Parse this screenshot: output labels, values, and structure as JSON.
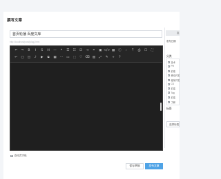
{
  "header": {
    "title": "撰写文章"
  },
  "post": {
    "title": "首页轮播 百度文库",
    "url_hint": "http://localhost/post/{slug}.html"
  },
  "editor": {
    "toolbar_row1": [
      {
        "icon": "undo-icon",
        "glyph": "↶"
      },
      {
        "icon": "redo-icon",
        "glyph": "↷"
      },
      {
        "icon": "bold-icon",
        "glyph": "B"
      },
      {
        "icon": "italic-icon",
        "glyph": "I"
      },
      {
        "icon": "strikethrough-icon",
        "glyph": "S"
      },
      {
        "icon": "heading-icon",
        "glyph": "H"
      },
      {
        "icon": "horizontal-rule-icon",
        "glyph": "—"
      },
      {
        "icon": "blockquote-icon",
        "glyph": "❝"
      },
      {
        "icon": "unordered-list-icon",
        "glyph": "☰"
      },
      {
        "icon": "ordered-list-icon",
        "glyph": "☷"
      },
      {
        "icon": "checklist-icon",
        "glyph": "☑"
      },
      {
        "icon": "indent-icon",
        "glyph": "⇥"
      },
      {
        "icon": "link-icon",
        "glyph": "⚭"
      },
      {
        "icon": "image-icon",
        "glyph": "▣"
      },
      {
        "icon": "code-icon",
        "glyph": "</>"
      },
      {
        "icon": "table-icon",
        "glyph": "▦"
      },
      {
        "icon": "info-icon",
        "glyph": "ⓘ"
      },
      {
        "icon": "chevron-right-icon",
        "glyph": "›"
      },
      {
        "icon": "upload-icon",
        "glyph": "⤒"
      },
      {
        "icon": "printer-icon",
        "glyph": "⎙"
      },
      {
        "icon": "square-icon",
        "glyph": "☐"
      },
      {
        "icon": "fullscreen-icon",
        "glyph": "⛶"
      }
    ],
    "toolbar_row2": [
      {
        "icon": "undo-alt-icon",
        "glyph": "↩"
      },
      {
        "icon": "calendar-icon",
        "glyph": "▢"
      },
      {
        "icon": "picture-icon",
        "glyph": "◫"
      },
      {
        "icon": "music-icon",
        "glyph": "♪"
      },
      {
        "icon": "video-icon",
        "glyph": "▶"
      },
      {
        "icon": "attachment-icon",
        "glyph": "⧉"
      },
      {
        "icon": "grid-icon",
        "glyph": "▦"
      },
      {
        "icon": "dash-icon",
        "glyph": "⋯"
      },
      {
        "icon": "layout-icon",
        "glyph": "▭"
      },
      {
        "icon": "frame-icon",
        "glyph": "⬚"
      },
      {
        "icon": "heart-icon",
        "glyph": "♡"
      },
      {
        "icon": "eraser-icon",
        "glyph": "⌫"
      },
      {
        "icon": "columns-icon",
        "glyph": "▥"
      },
      {
        "icon": "expand-icon",
        "glyph": "⤢"
      },
      {
        "icon": "pen-icon",
        "glyph": "✎"
      },
      {
        "icon": "plus-icon",
        "glyph": "+"
      },
      {
        "icon": "help-icon",
        "glyph": "?"
      }
    ]
  },
  "autosave": {
    "label": "自动文字段"
  },
  "actions": {
    "draft_label": "保存草稿",
    "publish_label": "发布文章"
  },
  "sidebar": {
    "top_button": "发布",
    "date_label": "发布日期",
    "categories_heading": "分类",
    "categories": [
      "技术",
      "PH",
      "前端",
      "移动开发",
      "程序开发",
      "CS",
      "前端",
      "Tag",
      "前端",
      "了解"
    ],
    "tags_heading": "标签",
    "select_button": "选择标签"
  }
}
